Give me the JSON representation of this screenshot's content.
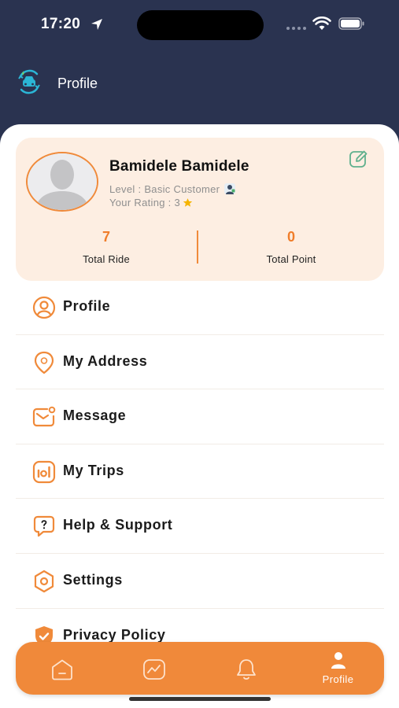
{
  "status_bar": {
    "time": "17:20"
  },
  "header": {
    "title": "Profile"
  },
  "profile": {
    "name": "Bamidele Bamidele",
    "level": "Level : Basic Customer",
    "rating": "Your Rating : 3",
    "stats": [
      {
        "value": "7",
        "label": "Total Ride"
      },
      {
        "value": "0",
        "label": "Total Point"
      }
    ]
  },
  "menu": [
    {
      "label": "Profile",
      "icon": "user-circle-icon"
    },
    {
      "label": "My Address",
      "icon": "location-pin-icon"
    },
    {
      "label": "Message",
      "icon": "message-icon"
    },
    {
      "label": "My Trips",
      "icon": "trips-icon"
    },
    {
      "label": "Help & Support",
      "icon": "help-chat-icon"
    },
    {
      "label": "Settings",
      "icon": "settings-icon"
    },
    {
      "label": "Privacy Policy",
      "icon": "shield-check-icon"
    }
  ],
  "bottom_nav": {
    "tabs": [
      {
        "icon": "home-icon",
        "label": ""
      },
      {
        "icon": "activity-icon",
        "label": ""
      },
      {
        "icon": "bell-icon",
        "label": ""
      },
      {
        "icon": "person-icon",
        "label": "Profile",
        "active": true
      }
    ]
  },
  "colors": {
    "header_bg": "#2a3350",
    "accent": "#f0893a",
    "card_bg": "#fdeee2",
    "star": "#f5b400"
  }
}
